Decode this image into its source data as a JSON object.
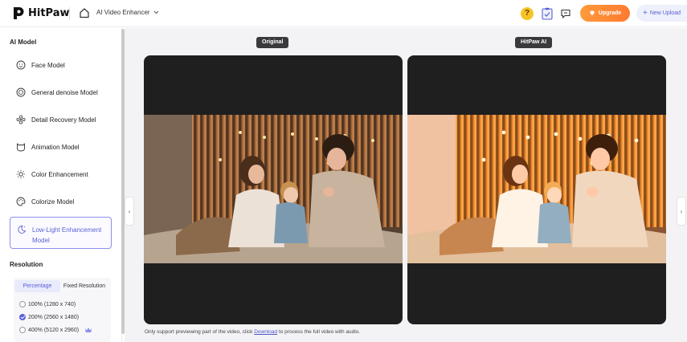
{
  "header": {
    "brand": "HitPaw",
    "product": "AI Video Enhancer",
    "help_glyph": "?",
    "upgrade_label": "Upgrade",
    "new_upload_label": "New Upload",
    "accent_color": "#5a5fd6",
    "upgrade_color": "#ff8a35"
  },
  "sidebar": {
    "ai_model_title": "AI Model",
    "models": [
      {
        "label": "Face Model",
        "icon": "face-icon"
      },
      {
        "label": "General denoise Model",
        "icon": "denoise-icon"
      },
      {
        "label": "Detail Recovery Model",
        "icon": "detail-icon"
      },
      {
        "label": "Animation Model",
        "icon": "animation-icon"
      },
      {
        "label": "Color Enhancement",
        "icon": "color-icon"
      },
      {
        "label": "Colorize Model",
        "icon": "colorize-icon"
      },
      {
        "label": "Low-Light Enhancement Model",
        "icon": "low-light-icon",
        "selected": true
      }
    ],
    "resolution_title": "Resolution",
    "resolution_tabs": [
      "Percentage",
      "Fixed Resolution"
    ],
    "resolution_options": [
      {
        "label": "100% (1280 x 740)",
        "checked": false
      },
      {
        "label": "200% (2560 x 1480)",
        "checked": true
      },
      {
        "label": "400% (5120 x 2960)",
        "checked": false,
        "premium": true
      }
    ]
  },
  "preview": {
    "original_label": "Original",
    "ai_label": "HitPaw AI",
    "footnote_before": "Only support previewing part of the video, click ",
    "footnote_link": "Download",
    "footnote_after": " to process the full video with audio."
  }
}
